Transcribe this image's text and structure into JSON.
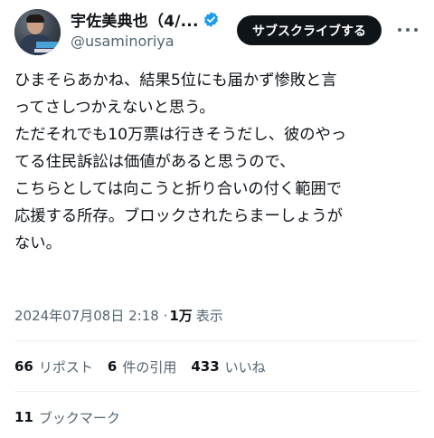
{
  "author": {
    "display_name": "宇佐美典也（4/...",
    "handle": "@usaminoriya",
    "verified_icon": "verified-badge-icon",
    "verified_color": "#1d9bf0"
  },
  "header": {
    "subscribe_label": "サブスクライブする",
    "more_icon": "more-dots-icon"
  },
  "tweet": {
    "lines": [
      "ひまそらあかね、結果5位にも届かず惨敗と言",
      "ってさしつかえないと思う。",
      "ただそれでも10万票は行きそうだし、彼のやっ",
      "てる住民訴訟は価値があると思うので、",
      "こちらとしては向こうと折り合いの付く範囲で",
      "応援する所存。ブロックされたらまーしょうが",
      "ない。"
    ]
  },
  "meta": {
    "datetime": "2024年07月08日 2:18 · ",
    "views_count": "1万",
    "views_label": "表示"
  },
  "stats": {
    "reposts": {
      "count": "66",
      "label": "リポスト"
    },
    "quotes": {
      "count": "6",
      "label": "件の引用"
    },
    "likes": {
      "count": "433",
      "label": "いいね"
    },
    "bookmarks": {
      "count": "11",
      "label": "ブックマーク"
    }
  },
  "colors": {
    "text_primary": "#0f1419",
    "text_secondary": "#536471",
    "button_bg": "#0f1419",
    "divider": "#eff3f4"
  }
}
